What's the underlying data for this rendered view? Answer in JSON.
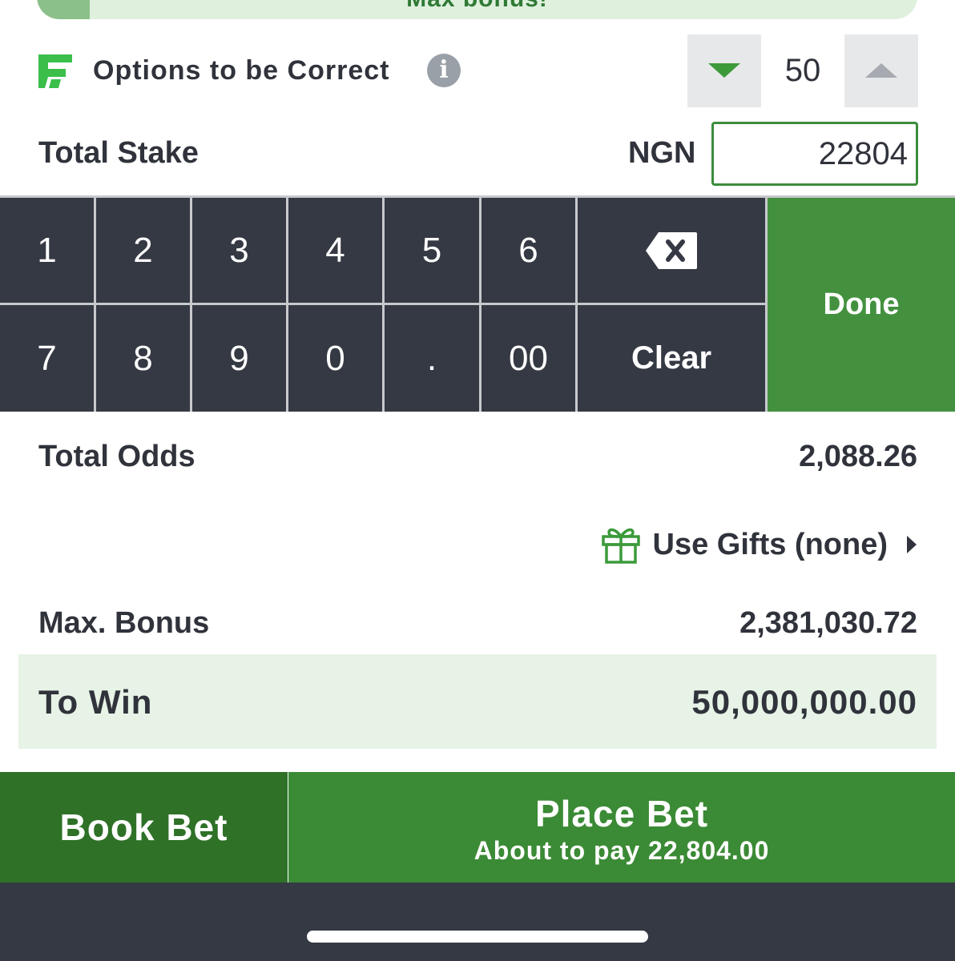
{
  "promo": {
    "text": "Max bonus!"
  },
  "options": {
    "label": "Options to be Correct",
    "value": "50",
    "info_glyph": "i",
    "logo_icon": "flex-logo-icon",
    "down_icon": "caret-down-icon",
    "up_icon": "caret-up-icon"
  },
  "stake": {
    "label": "Total Stake",
    "currency": "NGN",
    "value": "22804"
  },
  "keypad": {
    "row1": [
      "1",
      "2",
      "3",
      "4",
      "5",
      "6"
    ],
    "row2": [
      "7",
      "8",
      "9",
      "0",
      ".",
      "00"
    ],
    "backspace_icon": "backspace-icon",
    "clear_label": "Clear",
    "done_label": "Done"
  },
  "totals": {
    "odds_label": "Total Odds",
    "odds_value": "2,088.26",
    "gifts_label": "Use Gifts (none)",
    "gift_icon": "gift-icon",
    "bonus_label": "Max. Bonus",
    "bonus_value": "2,381,030.72",
    "to_win_label": "To Win",
    "to_win_value": "50,000,000.00"
  },
  "actions": {
    "book_bet": "Book Bet",
    "place_bet": "Place Bet",
    "place_bet_sub": "About to pay 22,804.00"
  },
  "colors": {
    "brand_green": "#43913f",
    "dark_green": "#2e7127",
    "keypad_dark": "#353943",
    "light_green": "#e6f3e6"
  }
}
